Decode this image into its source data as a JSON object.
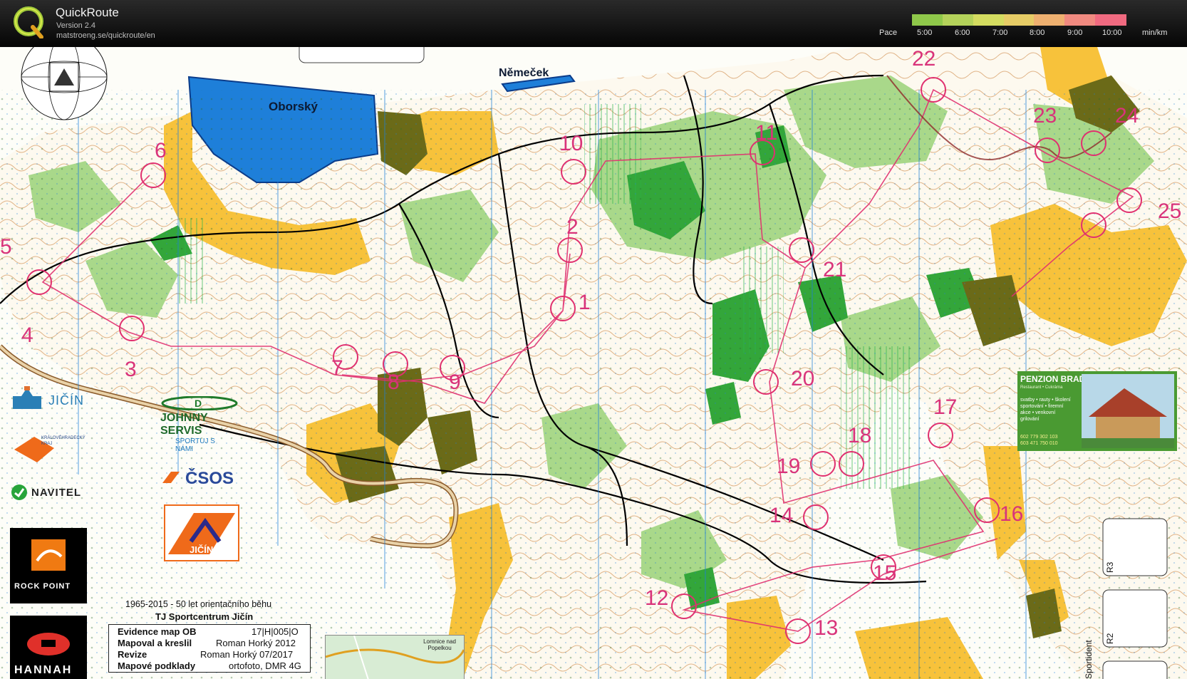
{
  "app": {
    "title": "QuickRoute",
    "version": "Version 2.4",
    "url": "matstroeng.se/quickroute/en"
  },
  "pace": {
    "label": "Pace",
    "ticks": [
      "5:00",
      "6:00",
      "7:00",
      "8:00",
      "9:00",
      "10:00"
    ],
    "unit": "min/km",
    "colors": [
      "#8fc84a",
      "#b4d25a",
      "#d4dc60",
      "#e6cc66",
      "#eeb070",
      "#f08a80",
      "#f06a80"
    ]
  },
  "map": {
    "lake_label": "Oborský",
    "pond_label": "Němeček",
    "control_numbers": [
      "1",
      "2",
      "3",
      "4",
      "5",
      "6",
      "7",
      "8",
      "9",
      "10",
      "11",
      "12",
      "13",
      "14",
      "15",
      "16",
      "17",
      "18",
      "19",
      "20",
      "21",
      "22",
      "23",
      "24",
      "25"
    ],
    "colors": {
      "open_land": "#f7c23b",
      "forest_green": "#33a63a",
      "light_green": "#a9d88a",
      "water": "#1e7fd9",
      "route": "#e0306f",
      "settlement": "#6b6a18",
      "contours": "#c7782e"
    }
  },
  "sponsors": {
    "city": "JIČÍN",
    "region": "KRÁLOVÉHRADECKÝ KRAJ",
    "navitel": "NAVITEL",
    "rockpoint": "ROCK POINT",
    "johnny": "JOHNNY SERVIS",
    "sportuj": "SPORTUJ S NÁMI",
    "csos": "ČSOS",
    "club_badge": "JIČÍN",
    "hannah": "HANNAH",
    "anniversary": "1965-2015 - 50 let orientačního běhu",
    "club": "TJ Sportcentrum Jičín"
  },
  "legend": {
    "r1_label": "Evidence map OB",
    "r1_value": "17|H|005|O",
    "r2_label": "Mapoval a kreslil",
    "r2_value": "Roman Horký 2012",
    "r3_label": "Revize",
    "r3_value": "Roman Horký 07/2017",
    "r4_label": "Mapové podklady",
    "r4_value": "ortofoto, DMR 4G"
  },
  "inset": {
    "town": "Lomnice nad Popelkou"
  },
  "ad": {
    "title": "PENZION BRADA",
    "subtitle": "Restaurant • Cukrárna",
    "lines": [
      "svatby • rauty • školení",
      "sportování • firemní",
      "akce • venkovní",
      "grilování"
    ],
    "phones": [
      "602 779 302 103",
      "603 471 750 010"
    ]
  },
  "side_boxes": [
    "R3",
    "R2"
  ],
  "side_text": "Sportident"
}
